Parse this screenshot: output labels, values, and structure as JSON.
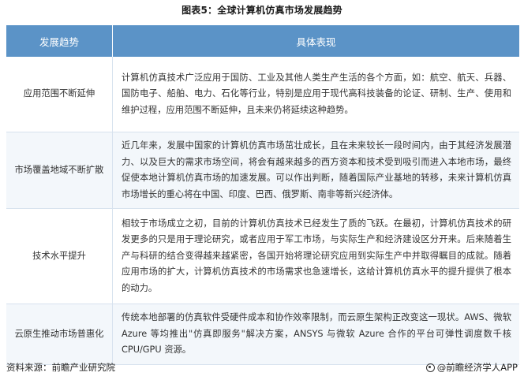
{
  "title": "图表5：全球计算机仿真市场发展趋势",
  "table": {
    "headers": [
      "发展趋势",
      "具体表现"
    ],
    "rows": [
      {
        "trend": "应用范围不断延伸",
        "detail": "计算机仿真技术广泛应用于国防、工业及其他人类生产生活的各个方面，如：航空、航天、兵器、国防电子、船舶、电力、石化等行业，特别是应用于现代高科技装备的论证、研制、生产、使用和维护过程，应用范围不断延伸，且未来仍将延续这种趋势。"
      },
      {
        "trend": "市场覆盖地域不断扩散",
        "detail": "近几年来，发展中国家的计算机仿真市场茁壮成长，且在未来较长一段时间内，由于其经济发展潜力、以及巨大的需求市场空间，将会有越来越多的西方资本和技术受到吸引而进入本地市场，最终促使本地计算机仿真市场的加速发展。可以作出判断，随着国际产业基地的转移，未来计算机仿真市场增长的重心将在中国、印度、巴西、俄罗斯、南非等新兴经济体。"
      },
      {
        "trend": "技术水平提升",
        "detail": "相较于市场成立之初，目前的计算机仿真技术已经发生了质的飞跃。在最初，计算机仿真技术的研发更多的只是用于理论研究，或者应用于军工市场，与实际生产和经济建设区分开来。后来随着生产与科研的结合变得越来越紧密，各国开始将理论研究应用到实际生产中并取得瞩目的成就。随着应用市场的扩大，计算机仿真技术的市场需求也急速增长，这给计算机仿真水平的提升提供了根本的动力。"
      },
      {
        "trend": "云原生推动市场普惠化",
        "detail": "传统本地部署的仿真软件受硬件成本和协作效率限制，而云原生架构正改变这一现状。AWS、微软 Azure 等均推出\"仿真即服务\"解决方案，ANSYS 与微软 Azure 合作的平台可弹性调度数千核 CPU/GPU 资源。"
      }
    ]
  },
  "footer": {
    "source": "资料来源：前瞻产业研究院",
    "brand": "@前瞻经济学人APP",
    "brand_icon": "qianzhan-logo-icon"
  },
  "colors": {
    "header_bg": "#5b93c7",
    "row_alt_bg": "#f3f7fb",
    "border": "#d7e2ee"
  }
}
